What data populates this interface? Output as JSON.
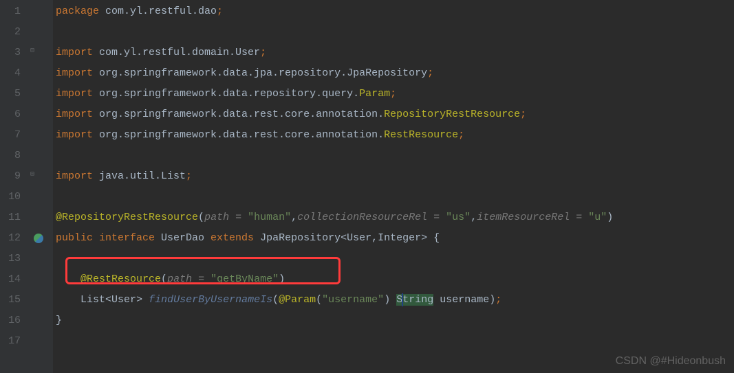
{
  "lines": {
    "1": {
      "num": "1"
    },
    "2": {
      "num": "2"
    },
    "3": {
      "num": "3"
    },
    "4": {
      "num": "4"
    },
    "5": {
      "num": "5"
    },
    "6": {
      "num": "6"
    },
    "7": {
      "num": "7"
    },
    "8": {
      "num": "8"
    },
    "9": {
      "num": "9"
    },
    "10": {
      "num": "10"
    },
    "11": {
      "num": "11"
    },
    "12": {
      "num": "12"
    },
    "13": {
      "num": "13"
    },
    "14": {
      "num": "14"
    },
    "15": {
      "num": "15"
    },
    "16": {
      "num": "16"
    },
    "17": {
      "num": "17"
    }
  },
  "code": {
    "package_kw": "package ",
    "package_name": "com.yl.restful.dao",
    "import_kw": "import ",
    "import1": "com.yl.restful.domain.User",
    "import2a": "org.springframework.data.jpa.repository.",
    "import2b": "JpaRepository",
    "import3a": "org.springframework.data.repository.query.",
    "import3b": "Param",
    "import4a": "org.springframework.data.rest.core.annotation.",
    "import4b": "RepositoryRestResource",
    "import5a": "org.springframework.data.rest.core.annotation.",
    "import5b": "RestResource",
    "import6": "java.util.List",
    "ann1": "@RepositoryRestResource",
    "ann1_p1": "path",
    "ann1_v1": "\"human\"",
    "ann1_p2": "collectionResourceRel",
    "ann1_v2": "\"us\"",
    "ann1_p3": "itemResourceRel",
    "ann1_v3": "\"u\"",
    "public_kw": "public ",
    "interface_kw": "interface ",
    "class_name": "UserDao ",
    "extends_kw": "extends ",
    "extends_type": "JpaRepository",
    "generic1": "User",
    "generic2": "Integer",
    "ann2": "@RestResource",
    "ann2_p1": "path",
    "ann2_v1": "\"getByName\"",
    "ret_type": "List",
    "ret_generic": "User",
    "method_name": "findUserByUsernameIs",
    "param_ann": "@Param",
    "param_ann_v": "\"username\"",
    "param_type_a": "S",
    "param_type_b": "tring",
    "param_name": " username",
    "eq": " = ",
    "comma": ",",
    "semi": ";",
    "lparen": "(",
    "rparen": ")",
    "lt": "<",
    "gt": ">",
    "lbrace": " {",
    "rbrace": "}"
  },
  "watermark": "CSDN @#Hideonbush"
}
